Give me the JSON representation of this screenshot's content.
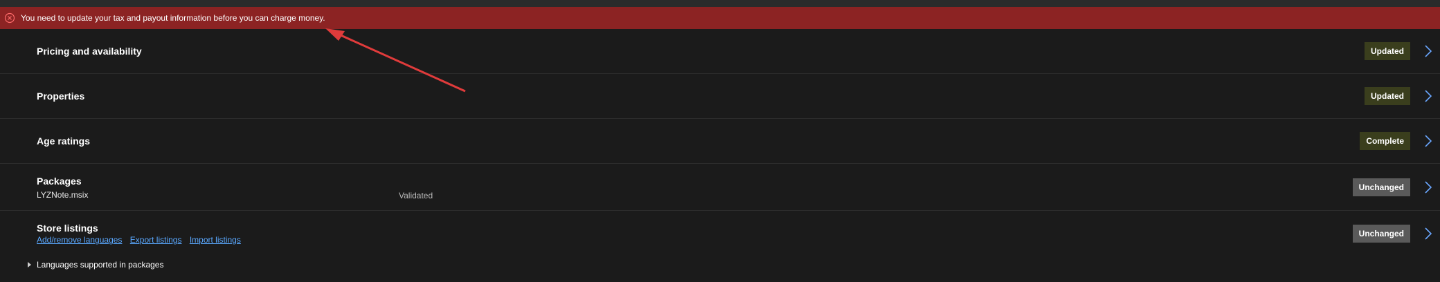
{
  "banner": {
    "message": "You need to update your tax and payout information before you can charge money.",
    "color": "#8c2323",
    "icon": "error-circle-icon"
  },
  "sections": [
    {
      "title": "Pricing and availability",
      "status": "Updated"
    },
    {
      "title": "Properties",
      "status": "Updated"
    },
    {
      "title": "Age ratings",
      "status": "Complete"
    },
    {
      "title": "Packages",
      "status": "Unchanged",
      "package_name": "LYZNote.msix",
      "package_state": "Validated"
    },
    {
      "title": "Store listings",
      "status": "Unchanged",
      "links": [
        "Add/remove languages",
        "Export listings",
        "Import listings"
      ]
    }
  ],
  "languages_toggle": "Languages supported in packages",
  "colors": {
    "status_green": "#3a3e1d",
    "status_gray": "#5a5a5a",
    "link": "#5aa8ff",
    "annotation_arrow": "#e03b3b"
  }
}
